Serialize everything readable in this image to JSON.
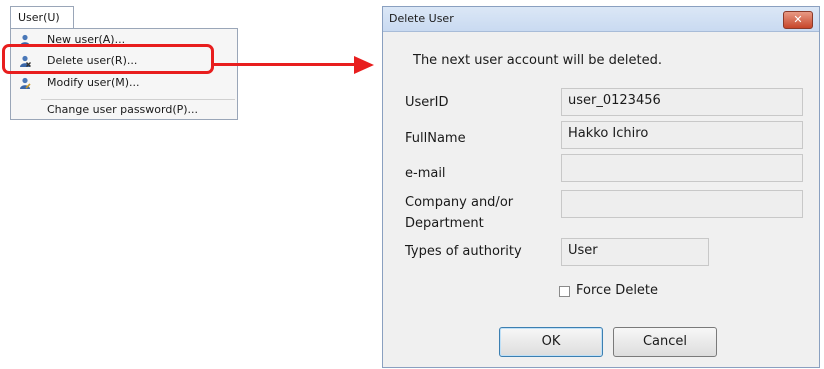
{
  "menu": {
    "title": "User(U)",
    "items": [
      {
        "label": "New user(A)...",
        "icon": "user-add-icon"
      },
      {
        "label": "Delete user(R)...",
        "icon": "user-delete-icon"
      },
      {
        "label": "Modify user(M)...",
        "icon": "user-edit-icon"
      },
      {
        "label": "Change user password(P)..."
      }
    ],
    "highlight_color": "#e81e1e"
  },
  "dialog": {
    "title": "Delete User",
    "close_glyph": "✕",
    "message": "The next user account will be deleted.",
    "fields": [
      {
        "label": "UserID",
        "value": "user_0123456"
      },
      {
        "label": "FullName",
        "value": "Hakko Ichiro"
      },
      {
        "label": "e-mail",
        "value": ""
      },
      {
        "label": "Company and/or",
        "label2": "Department",
        "value": ""
      },
      {
        "label": "Types of authority",
        "value": "User"
      }
    ],
    "force_delete": {
      "label": "Force Delete",
      "checked": false
    },
    "buttons": {
      "ok": "OK",
      "cancel": "Cancel"
    }
  }
}
